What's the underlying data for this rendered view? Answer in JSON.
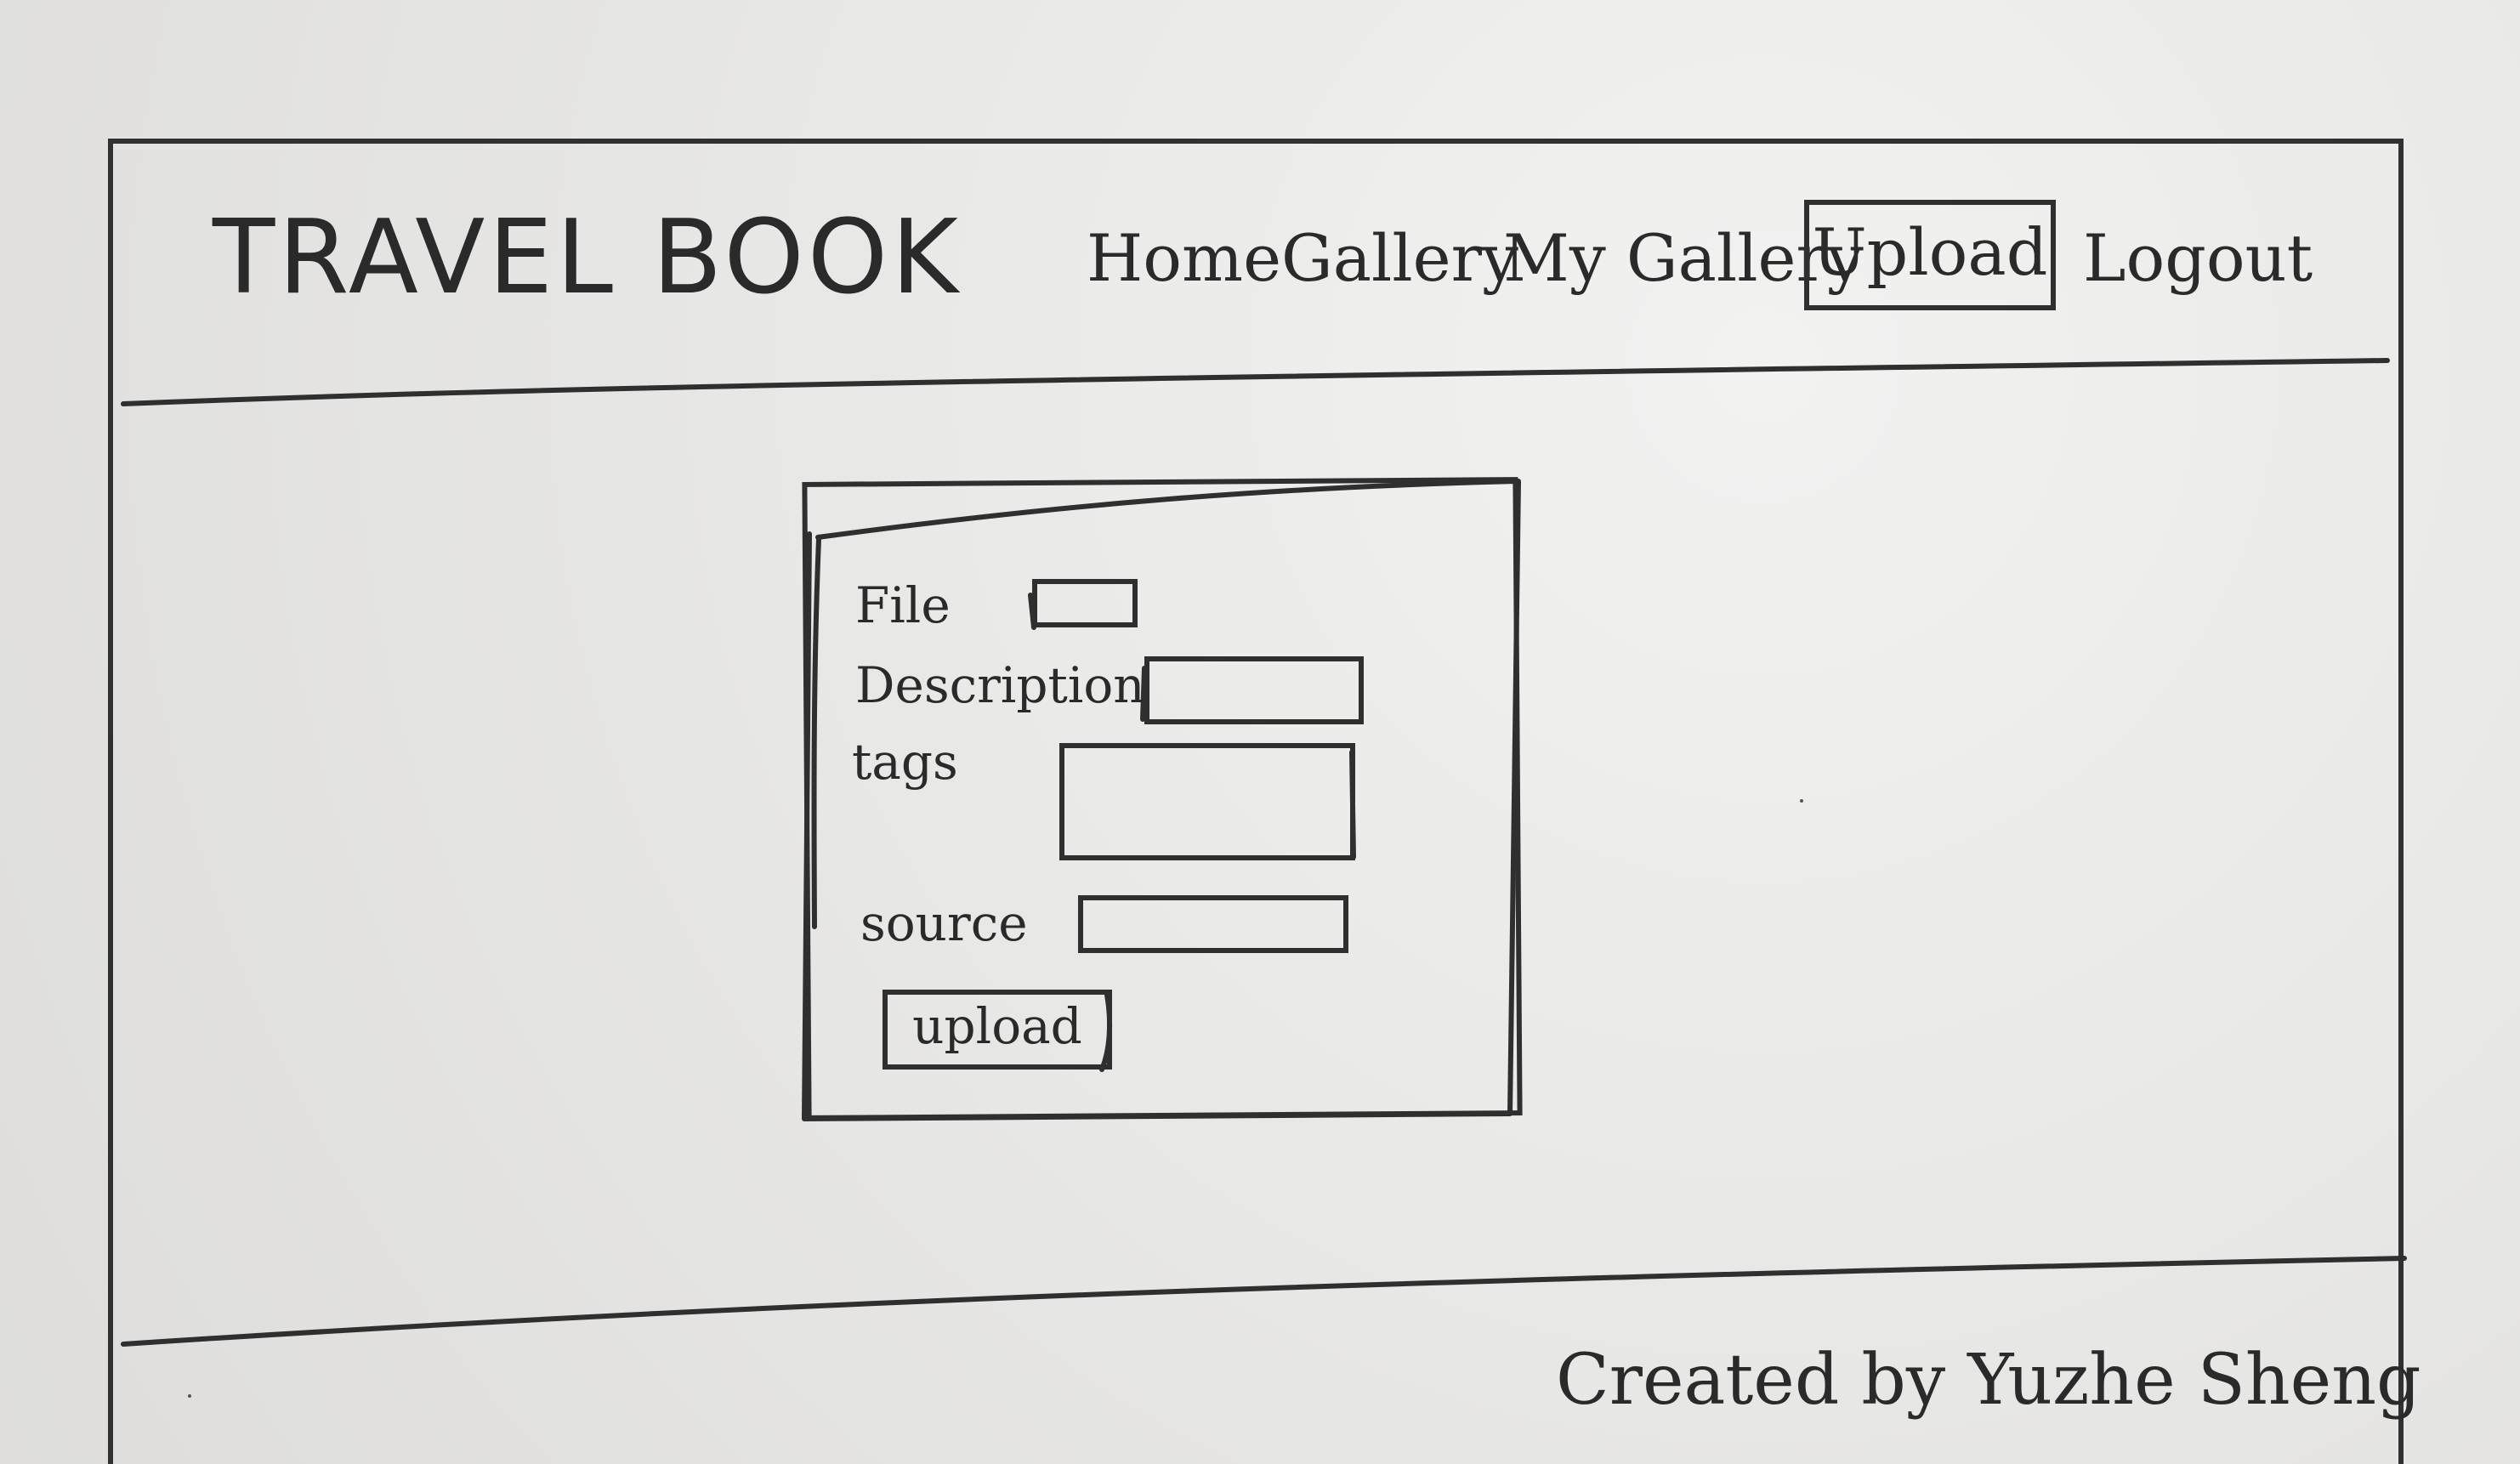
{
  "header": {
    "brand": "TRAVEL BOOK",
    "nav": {
      "home": "Home",
      "gallery": "Gallery",
      "my_gallery": "My Gallery",
      "upload": "Upload",
      "logout": "Logout"
    }
  },
  "upload_form": {
    "file_label": "File",
    "description_label": "Description",
    "tags_label": "tags",
    "source_label": "source",
    "file_value": "",
    "description_value": "",
    "tags_value": "",
    "source_value": "",
    "submit_label": "upload"
  },
  "footer": {
    "credit": "Created by Yuzhe Sheng"
  }
}
